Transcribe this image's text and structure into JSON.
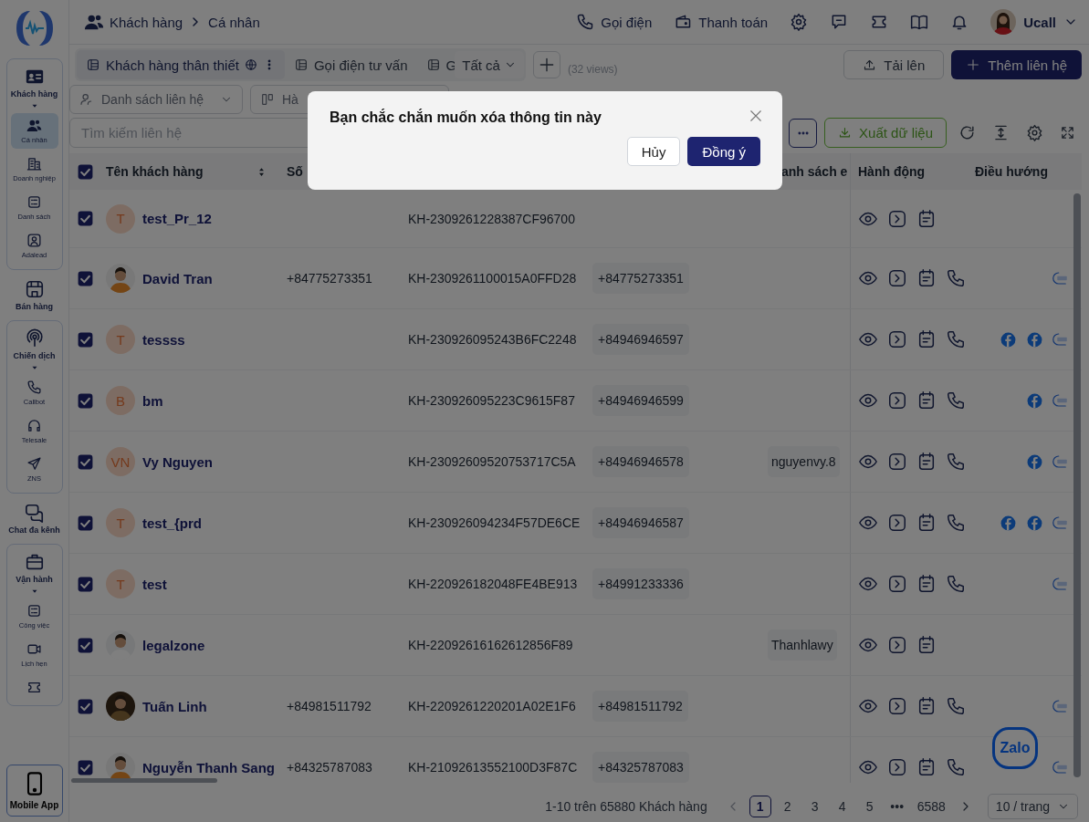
{
  "sidebar": {
    "groups": [
      {
        "label": "Khách hàng",
        "expanded": true,
        "items": [
          {
            "label": "Cá nhân",
            "selected": true
          },
          {
            "label": "Doanh nghiệp",
            "selected": false
          },
          {
            "label": "Danh sách",
            "selected": false
          },
          {
            "label": "Adalead",
            "selected": false
          }
        ]
      },
      {
        "label": "Bán hàng"
      },
      {
        "label": "Chiến dịch",
        "expanded": true,
        "items": [
          {
            "label": "Callbot",
            "selected": false
          },
          {
            "label": "Telesale",
            "selected": false
          },
          {
            "label": "ZNS",
            "selected": false
          }
        ]
      },
      {
        "label": "Chat đa kênh"
      },
      {
        "label": "Vận hành",
        "expanded": true,
        "items": [
          {
            "label": "Công việc",
            "selected": false
          },
          {
            "label": "Lịch hẹn",
            "selected": false
          },
          {
            "selected": false
          }
        ]
      }
    ],
    "mobile_app": "Mobile App"
  },
  "breadcrumb": [
    "Khách hàng",
    "Cá nhân"
  ],
  "top_actions": [
    "Gọi điện",
    "Thanh toán"
  ],
  "user": {
    "name": "Ucall"
  },
  "views": {
    "tabs": [
      {
        "label": "Khách hàng thân thiết",
        "selected": true
      },
      {
        "label": "Gọi điện tư vấn",
        "selected": false
      },
      {
        "label": "G",
        "selected": false
      }
    ],
    "scope": "Tất cả",
    "count": "(32 views)"
  },
  "upload_button": "Tải lên",
  "add_button": "Thêm liên hệ",
  "filters": [
    {
      "label": "Danh sách liên hệ",
      "kind": "dropdown"
    },
    {
      "label": "Hà",
      "kind": "button"
    }
  ],
  "search": {
    "placeholder": "Tìm kiếm liên hệ"
  },
  "export_button": "Xuất dữ liệu",
  "table": {
    "all_checked": true,
    "columns": [
      {
        "label": "Tên khách hàng"
      },
      {
        "label": "Số"
      },
      {},
      {},
      {
        "label": "anh sách e"
      },
      {
        "label": "Hành động"
      },
      {
        "label": "Điều hướng"
      }
    ],
    "rows": [
      {
        "checked": true,
        "avatar": {
          "kind": "letter",
          "text": "T"
        },
        "name": "test_Pr_12",
        "code": "KH-2309261228387CF96700",
        "call": false
      },
      {
        "checked": true,
        "avatar": {
          "kind": "picture"
        },
        "name": "David Tran",
        "phone": "+84775273351",
        "code": "KH-2309261100015A0FFD28",
        "phone_2": "+84775273351",
        "call": true,
        "links": [
          {
            "kind": "zalo"
          }
        ]
      },
      {
        "checked": true,
        "avatar": {
          "kind": "letter",
          "text": "T"
        },
        "name": "tessss",
        "code": "KH-230926095243B6FC2248",
        "phone_2": "+84946946597",
        "call": true,
        "links": [
          {
            "kind": "facebook"
          },
          {
            "kind": "facebook"
          },
          {
            "kind": "zalo"
          }
        ]
      },
      {
        "checked": true,
        "avatar": {
          "kind": "letter",
          "text": "B"
        },
        "name": "bm",
        "code": "KH-230926095223C9615F87",
        "phone_2": "+84946946599",
        "call": true,
        "links": [
          {
            "kind": "facebook"
          },
          {
            "kind": "zalo"
          }
        ]
      },
      {
        "checked": true,
        "avatar": {
          "kind": "letter",
          "text": "VN"
        },
        "name": "Vy Nguyen",
        "code": "KH-23092609520753717C5A",
        "phone_2": "+84946946578",
        "email": "nguyenvy.8",
        "call": true,
        "links": [
          {
            "kind": "facebook"
          },
          {
            "kind": "zalo"
          }
        ]
      },
      {
        "checked": true,
        "avatar": {
          "kind": "letter",
          "text": "T"
        },
        "name": "test_{prd",
        "code": "KH-230926094234F57DE6CE",
        "phone_2": "+84946946587",
        "call": true,
        "links": [
          {
            "kind": "facebook"
          },
          {
            "kind": "facebook"
          },
          {
            "kind": "zalo"
          }
        ]
      },
      {
        "checked": true,
        "avatar": {
          "kind": "letter",
          "text": "T"
        },
        "name": "test",
        "code": "KH-220926182048FE4BE913",
        "phone_2": "+84991233336",
        "call": true,
        "links": [
          {
            "kind": "zalo"
          }
        ]
      },
      {
        "checked": true,
        "avatar": {
          "kind": "picture"
        },
        "name": "legalzone",
        "code": "KH-22092616162612856F89",
        "email": "Thanhlawy",
        "call": false
      },
      {
        "checked": true,
        "avatar": {
          "kind": "picture"
        },
        "name": "Tuấn Linh",
        "phone": "+84981511792",
        "code": "KH-2209261220201A02E1F6",
        "phone_2": "+84981511792",
        "call": true,
        "links": [
          {
            "kind": "zalo"
          }
        ]
      },
      {
        "checked": true,
        "avatar": {
          "kind": "picture"
        },
        "name": "Nguyễn Thanh Sang",
        "phone": "+84325787083",
        "code": "KH-21092613552100D3F87C",
        "phone_2": "+84325787083",
        "call": true,
        "links": [
          {
            "kind": "zalo"
          }
        ]
      }
    ]
  },
  "pagination": {
    "summary": "1-10 trên 65880 Khách hàng",
    "pages": [
      {
        "label": "1",
        "selected": true
      },
      {
        "label": "2",
        "selected": false
      },
      {
        "label": "3",
        "selected": false
      },
      {
        "label": "4",
        "selected": false
      },
      {
        "label": "5",
        "selected": false
      },
      {
        "label": "•••",
        "selected": false
      },
      {
        "label": "6588",
        "selected": false
      }
    ],
    "page_size": "10 / trang"
  },
  "zalo_button": "Zalo",
  "dialog": {
    "title": "Bạn chắc chắn muốn xóa thông tin này",
    "cancel": "Hủy",
    "confirm": "Đồng ý"
  }
}
